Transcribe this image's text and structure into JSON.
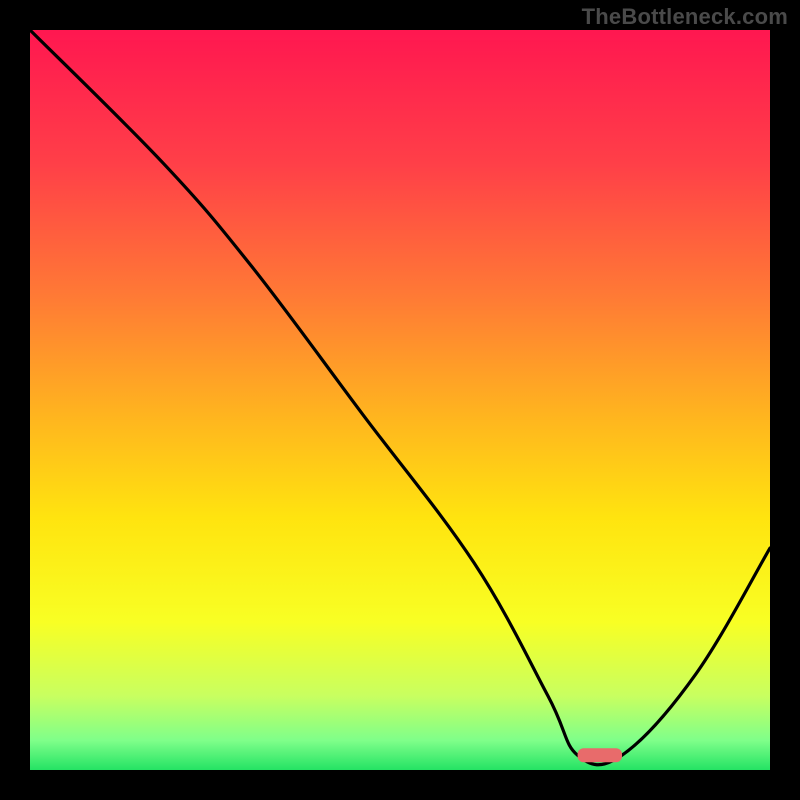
{
  "branding": {
    "watermark": "TheBottleneck.com"
  },
  "colors": {
    "page_bg": "#000000",
    "line": "#000000",
    "marker": "#e86b6b",
    "gradient_stops": [
      {
        "offset": 0.0,
        "color": "#ff1750"
      },
      {
        "offset": 0.18,
        "color": "#ff3f48"
      },
      {
        "offset": 0.36,
        "color": "#ff7a35"
      },
      {
        "offset": 0.52,
        "color": "#ffb41f"
      },
      {
        "offset": 0.66,
        "color": "#ffe40f"
      },
      {
        "offset": 0.8,
        "color": "#f8ff24"
      },
      {
        "offset": 0.9,
        "color": "#c8ff60"
      },
      {
        "offset": 0.96,
        "color": "#7fff8a"
      },
      {
        "offset": 1.0,
        "color": "#24e364"
      }
    ]
  },
  "chart_data": {
    "type": "line",
    "title": "",
    "xlabel": "",
    "ylabel": "",
    "xlim": [
      0,
      100
    ],
    "ylim": [
      0,
      100
    ],
    "series": [
      {
        "name": "curve",
        "x": [
          0,
          18,
          30,
          45,
          60,
          70,
          74,
          80,
          90,
          100
        ],
        "y": [
          100,
          82,
          68,
          48,
          28,
          10,
          2,
          2,
          13,
          30
        ]
      }
    ],
    "marker": {
      "name": "target-range",
      "x_start": 74,
      "x_end": 80,
      "y": 2
    }
  }
}
